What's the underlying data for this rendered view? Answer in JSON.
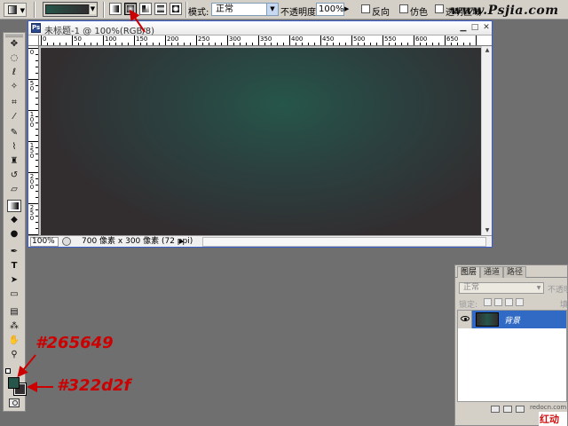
{
  "options_bar": {
    "mode_label": "模式:",
    "mode_value": "正常",
    "opacity_label": "不透明度:",
    "opacity_value": "100%",
    "reverse_label": "反向",
    "dither_label": "仿色",
    "transparency_label": "透明区域",
    "gradient_types": [
      "linear",
      "radial",
      "angle",
      "reflected",
      "diamond"
    ],
    "selected_gradient_type": "radial",
    "reverse_checked": false,
    "dither_checked": false,
    "transparency_checked": false
  },
  "watermark": "www.Psjia.com",
  "document": {
    "title": "未标题-1 @ 100%(RGB/8)",
    "zoom": "100%",
    "info": "700 像素 x 300 像素 (72 ppi)",
    "ruler_top_labels": [
      "0",
      "50",
      "100",
      "150",
      "200",
      "250",
      "300",
      "350",
      "400",
      "450",
      "500",
      "550",
      "600",
      "650"
    ],
    "ruler_left_labels": [
      "0",
      "5\n0",
      "1\n0\n0",
      "1\n5\n0",
      "2\n0\n0",
      "2\n5\n0"
    ]
  },
  "colors": {
    "foreground": "#265649",
    "background": "#322d2f",
    "annotation": "#cc0000"
  },
  "annotations": {
    "foreground_hex": "#265649",
    "background_hex": "#322d2f"
  },
  "layers_panel": {
    "tabs": [
      "图层",
      "通道",
      "路径"
    ],
    "blend_mode": "正常",
    "opacity_label": "不透明",
    "lock_label": "锁定:",
    "fill_label": "填",
    "layer_name": "背景",
    "footer_watermark": "redocn.com",
    "footer_logo": "红动中国"
  },
  "toolbox": {
    "tools": [
      "move-icon",
      "marquee-icon",
      "lasso-icon",
      "magic-wand-icon",
      "crop-icon",
      "eyedropper-icon",
      "healing-brush-icon",
      "brush-icon",
      "clone-stamp-icon",
      "history-brush-icon",
      "eraser-icon",
      "gradient-icon",
      "blur-icon",
      "dodge-icon",
      "pen-icon",
      "type-icon",
      "path-select-icon",
      "shape-icon",
      "notes-icon",
      "measure-icon",
      "hand-icon",
      "zoom-icon"
    ]
  }
}
